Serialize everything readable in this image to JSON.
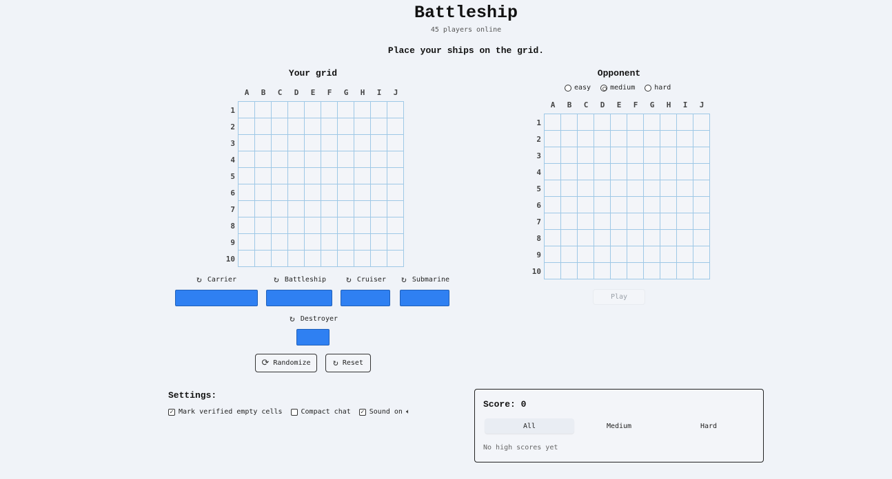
{
  "header": {
    "title": "Battleship",
    "online": "45 players online",
    "instruction": "Place your ships on the grid."
  },
  "columns": [
    "A",
    "B",
    "C",
    "D",
    "E",
    "F",
    "G",
    "H",
    "I",
    "J"
  ],
  "rows": [
    "1",
    "2",
    "3",
    "4",
    "5",
    "6",
    "7",
    "8",
    "9",
    "10"
  ],
  "your_grid": {
    "title": "Your grid"
  },
  "opponent": {
    "title": "Opponent",
    "difficulty_options": [
      "easy",
      "medium",
      "hard"
    ],
    "selected_difficulty": "medium",
    "play_label": "Play"
  },
  "ships": {
    "carrier": "Carrier",
    "battleship": "Battleship",
    "cruiser": "Cruiser",
    "submarine": "Submarine",
    "destroyer": "Destroyer",
    "rotate_icon": "rotate-icon",
    "color": "#2f80f2"
  },
  "actions": {
    "randomize": "Randomize",
    "reset": "Reset"
  },
  "settings": {
    "title": "Settings:",
    "mark_empty": "Mark verified empty cells",
    "compact_chat": "Compact chat",
    "sound_on": "Sound on",
    "mark_empty_checked": true,
    "compact_chat_checked": false,
    "sound_on_checked": true
  },
  "score": {
    "label": "Score:",
    "value": "0",
    "tabs": [
      "All",
      "Medium",
      "Hard"
    ],
    "active_tab": "All",
    "empty": "No high scores yet"
  }
}
